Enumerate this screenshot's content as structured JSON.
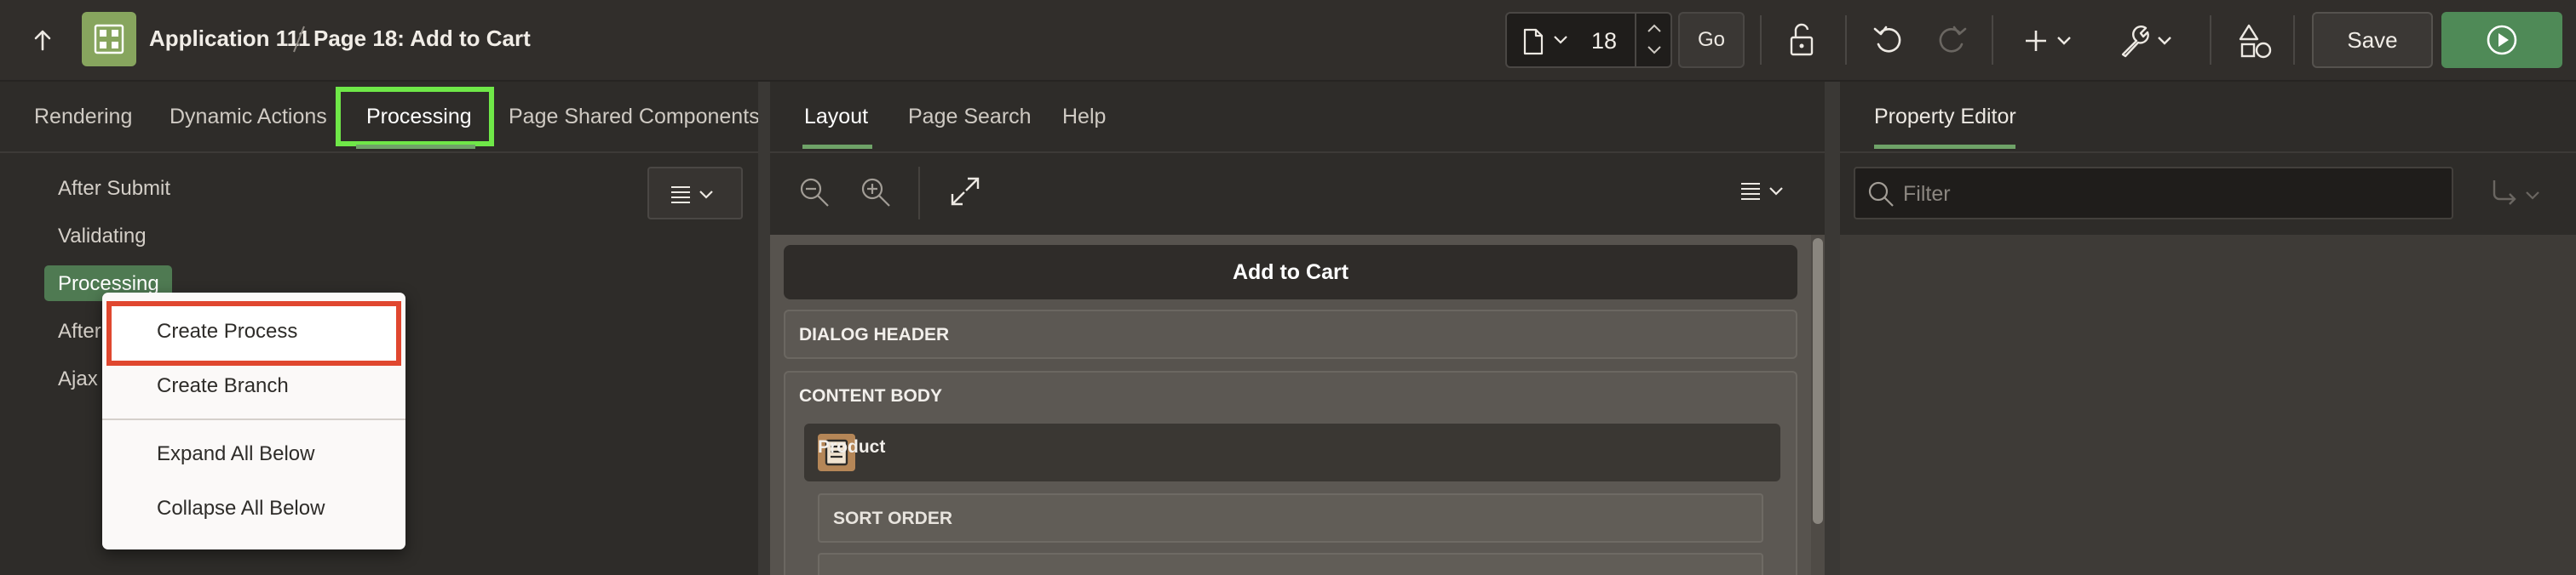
{
  "header": {
    "app_title": "Application 111",
    "page_title": "Page 18: Add to Cart",
    "page_number": "18",
    "go_label": "Go",
    "save_label": "Save"
  },
  "left_panel": {
    "tabs": [
      {
        "label": "Rendering"
      },
      {
        "label": "Dynamic Actions"
      },
      {
        "label": "Processing",
        "active": true
      },
      {
        "label": "Page Shared Components"
      }
    ],
    "tree": [
      {
        "label": "After Submit"
      },
      {
        "label": "Validating"
      },
      {
        "label": "Processing",
        "selected": true
      },
      {
        "label": "After Processing",
        "visible_text": "After"
      },
      {
        "label": "Ajax Callback",
        "visible_text": "Ajax"
      }
    ]
  },
  "context_menu": {
    "items": [
      {
        "label": "Create Process",
        "highlighted": true
      },
      {
        "label": "Create Branch"
      },
      {
        "label": "Expand All Below"
      },
      {
        "label": "Collapse All Below"
      }
    ]
  },
  "middle_panel": {
    "tabs": [
      {
        "label": "Layout",
        "active": true
      },
      {
        "label": "Page Search"
      },
      {
        "label": "Help"
      }
    ],
    "layout": {
      "page_bar": "Add to Cart",
      "dialog_header": "DIALOG HEADER",
      "content_body": "CONTENT BODY",
      "region_title": "Product",
      "item_row": "SORT ORDER"
    }
  },
  "right_panel": {
    "tab": "Property Editor",
    "filter_placeholder": "Filter"
  },
  "colors": {
    "accent_green": "#4f8a57",
    "highlight_tab_outline": "#6fe848",
    "highlight_menu_outline": "#e0472f",
    "app_tile": "#87a55e"
  },
  "icons": [
    "up-arrow-icon",
    "app-icon",
    "page-icon",
    "chevron-down-icon",
    "lock-icon",
    "undo-icon",
    "redo-icon",
    "plus-icon",
    "wrench-icon",
    "shared-components-icon",
    "run-icon",
    "menu-icon",
    "zoom-out-icon",
    "zoom-in-icon",
    "expand-icon",
    "search-icon",
    "goto-icon",
    "region-icon"
  ]
}
